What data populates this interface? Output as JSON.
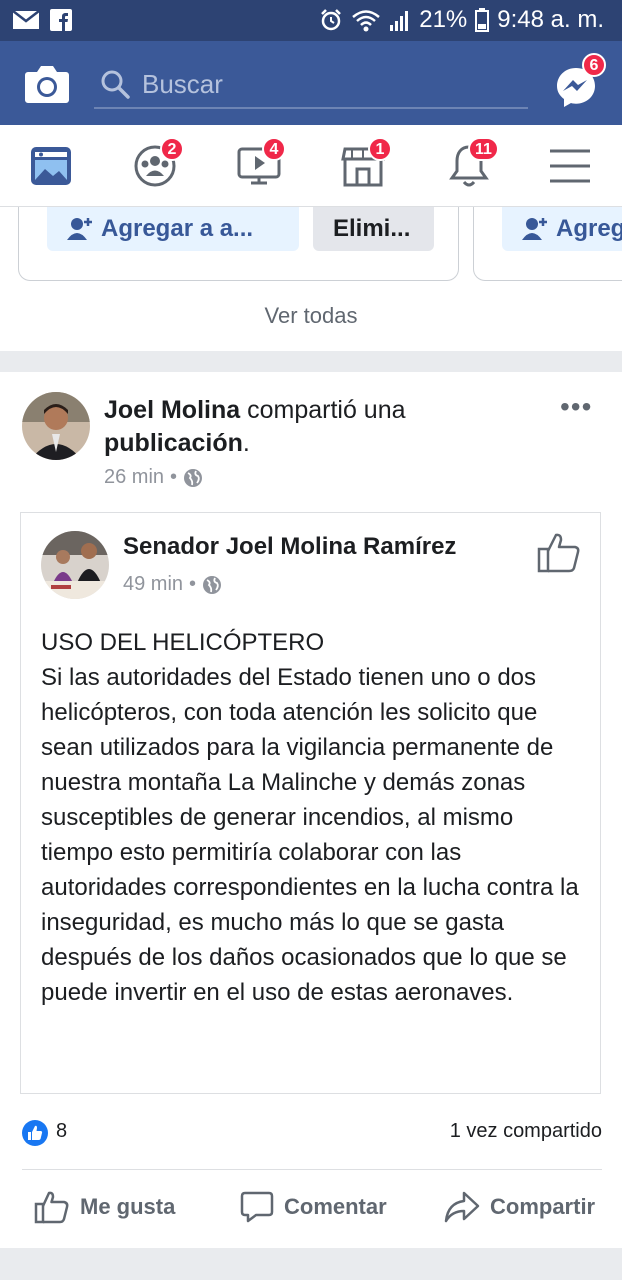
{
  "status_bar": {
    "battery": "21%",
    "time": "9:48 a. m."
  },
  "header": {
    "search_placeholder": "Buscar",
    "messenger_badge": "6"
  },
  "nav": {
    "items": [
      {
        "icon": "news-feed-icon",
        "badge": ""
      },
      {
        "icon": "groups-icon",
        "badge": "2"
      },
      {
        "icon": "watch-icon",
        "badge": "4"
      },
      {
        "icon": "marketplace-icon",
        "badge": "1"
      },
      {
        "icon": "notifications-icon",
        "badge": "11"
      },
      {
        "icon": "menu-icon",
        "badge": ""
      }
    ]
  },
  "suggestions": {
    "add_label": "Agregar a a...",
    "delete_label": "Elimi...",
    "add_label_partial": "Agreg",
    "see_all": "Ver todas"
  },
  "post": {
    "author": "Joel Molina",
    "action_text": " compartió una ",
    "action_object": "publicación",
    "action_end": ".",
    "time": "26 min",
    "shared": {
      "author": "Senador Joel Molina Ramírez",
      "time": "49 min",
      "body": "USO DEL HELICÓPTERO\nSi las autoridades del Estado tienen uno o dos helicópteros, con toda atención les solicito que sean utilizados para la vigilancia permanente de nuestra montaña La Malinche y demás zonas susceptibles de generar incendios, al mismo tiempo esto permitiría colaborar con las autoridades correspondientes en la lucha contra la inseguridad, es mucho más lo que se gasta después de los daños ocasionados que lo que se puede invertir en el uso de estas aeronaves."
    },
    "like_count": "8",
    "share_count": "1 vez compartido",
    "actions": {
      "like": "Me gusta",
      "comment": "Comentar",
      "share": "Compartir"
    }
  },
  "colors": {
    "brand": "#3b5998",
    "badge": "#f02849",
    "like_blue": "#1877f2"
  }
}
